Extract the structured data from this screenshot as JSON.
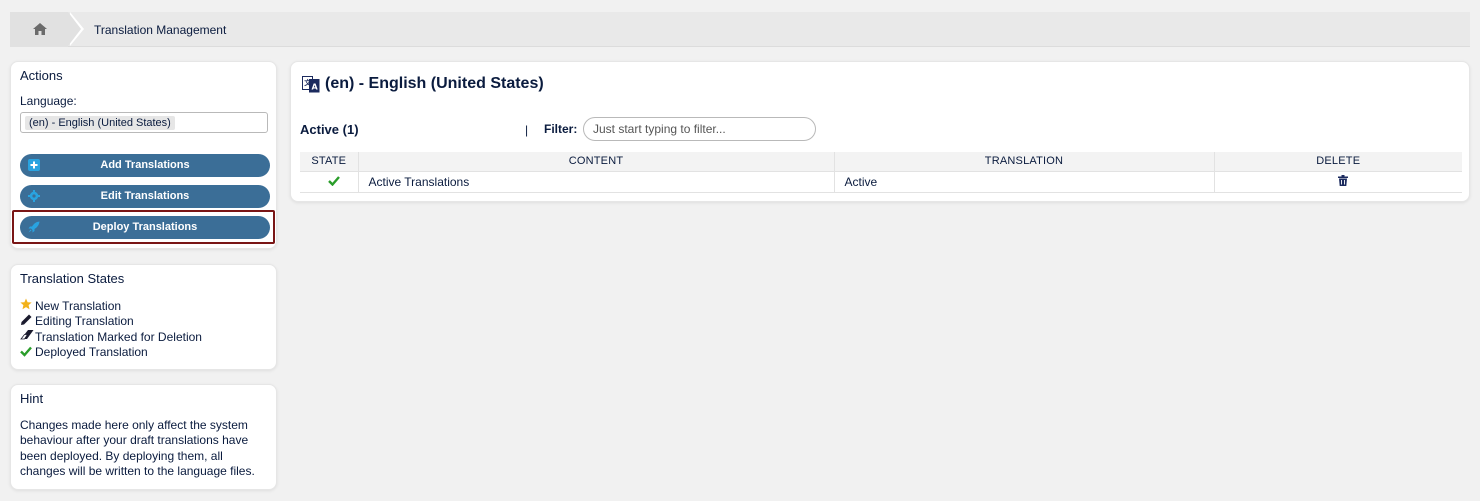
{
  "breadcrumb": {
    "home_icon": "home-icon",
    "current": "Translation Management"
  },
  "actions": {
    "title": "Actions",
    "language_label": "Language:",
    "language_value": "(en) - English (United States)",
    "buttons": {
      "add": "Add Translations",
      "edit": "Edit Translations",
      "deploy": "Deploy Translations"
    }
  },
  "states": {
    "title": "Translation States",
    "items": [
      {
        "icon": "star-icon",
        "label": "New Translation"
      },
      {
        "icon": "pencil-icon",
        "label": "Editing Translation"
      },
      {
        "icon": "eraser-icon",
        "label": "Translation Marked for Deletion"
      },
      {
        "icon": "check-icon",
        "label": "Deployed Translation"
      }
    ]
  },
  "hint": {
    "title": "Hint",
    "text": "Changes made here only affect the system behaviour after your draft translations have been deployed. By deploying them, all changes will be written to the language files."
  },
  "main": {
    "title": "(en) - English (United States)",
    "active_label": "Active (1)",
    "separator": "|",
    "filter_label": "Filter:",
    "filter_placeholder": "Just start typing to filter...",
    "table": {
      "headers": [
        "STATE",
        "CONTENT",
        "TRANSLATION",
        "DELETE"
      ],
      "rows": [
        {
          "state": "check-icon",
          "content": "Active Translations",
          "translation": "Active",
          "delete": "trash-icon"
        }
      ]
    }
  },
  "colors": {
    "button_bg": "#3b6e97",
    "highlight_border": "#7a1616",
    "check_green": "#2a9d2a",
    "star_gold": "#f2b21b"
  }
}
